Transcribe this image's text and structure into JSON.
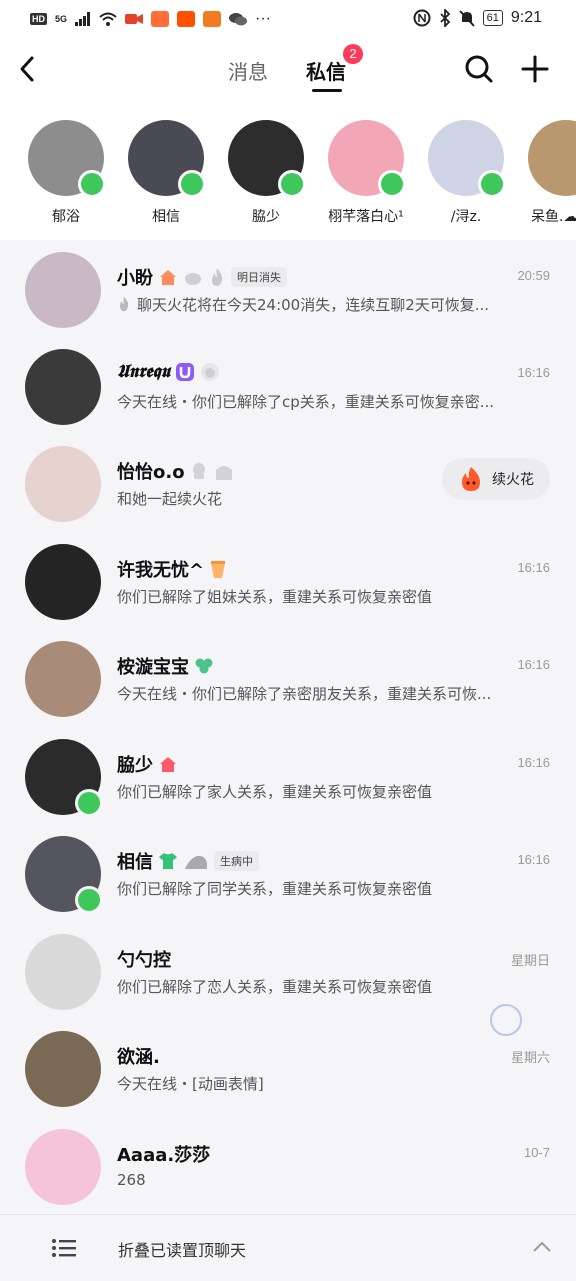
{
  "status_bar": {
    "network": "HD",
    "network_gen": "5G",
    "battery": "61",
    "time": "9:21"
  },
  "nav": {
    "tabs": [
      {
        "label": "消息"
      },
      {
        "label": "私信",
        "badge": "2"
      }
    ],
    "icons": [
      "back-icon",
      "search-icon",
      "plus-icon"
    ]
  },
  "stories": [
    {
      "name": "郁浴",
      "online": true,
      "color": "#8d8d8d"
    },
    {
      "name": "相信",
      "online": true,
      "color": "#4a4a55"
    },
    {
      "name": "脇少",
      "online": true,
      "color": "#2d2d2d"
    },
    {
      "name": "栩芊落白心¹",
      "online": true,
      "color": "#f2a7b6"
    },
    {
      "name": "/浔z.",
      "online": true,
      "color": "#cfd3e6"
    },
    {
      "name": "呆鱼.☁",
      "online": false,
      "color": "#b9976f"
    }
  ],
  "chats": [
    {
      "name": "小盼",
      "tag": "明日消失",
      "message": "聊天火花将在今天24:00消失，连续互聊2天可恢复...",
      "time": "20:59",
      "online": false,
      "color": "#c9b9c4"
    },
    {
      "name": "𝖀𝖓𝖗𝖊𝖖𝖚",
      "tag": "",
      "message": "今天在线・你们已解除了cp关系，重建关系可恢复亲密...",
      "time": "16:16",
      "online": false,
      "color": "#3a3a3a"
    },
    {
      "name": "怡怡o.o",
      "tag": "",
      "message": "和她一起续火花",
      "time": "",
      "online": false,
      "color": "#e6d2cf",
      "action": "续火花"
    },
    {
      "name": "许我无忧^",
      "tag": "",
      "message": "你们已解除了姐妹关系，重建关系可恢复亲密值",
      "time": "16:16",
      "online": false,
      "color": "#242424"
    },
    {
      "name": "桉漩宝宝",
      "tag": "",
      "message": "今天在线・你们已解除了亲密朋友关系，重建关系可恢...",
      "time": "16:16",
      "online": false,
      "color": "#a98b7a"
    },
    {
      "name": "脇少",
      "tag": "",
      "message": "你们已解除了家人关系，重建关系可恢复亲密值",
      "time": "16:16",
      "online": true,
      "color": "#2b2b2b"
    },
    {
      "name": "相信",
      "tag": "生病中",
      "message": "你们已解除了同学关系，重建关系可恢复亲密值",
      "time": "16:16",
      "online": true,
      "color": "#55555f"
    },
    {
      "name": "勺勺控",
      "tag": "",
      "message": "你们已解除了恋人关系，重建关系可恢复亲密值",
      "time": "星期日",
      "online": false,
      "color": "#d9d9d9"
    },
    {
      "name": "欲涵.",
      "tag": "",
      "message": "今天在线・[动画表情]",
      "time": "星期六",
      "online": false,
      "color": "#7a6a55"
    },
    {
      "name": "Aaaa.莎莎",
      "tag": "",
      "message": "268",
      "time": "10-7",
      "online": false,
      "color": "#f4c5d6"
    }
  ],
  "footer": {
    "label": "折叠已读置顶聊天",
    "icons": [
      "list-icon",
      "chevron-up-icon"
    ]
  },
  "colors": {
    "online": "#3ec85b",
    "badge": "#ff3b5c",
    "background": "#f5f5f7"
  }
}
